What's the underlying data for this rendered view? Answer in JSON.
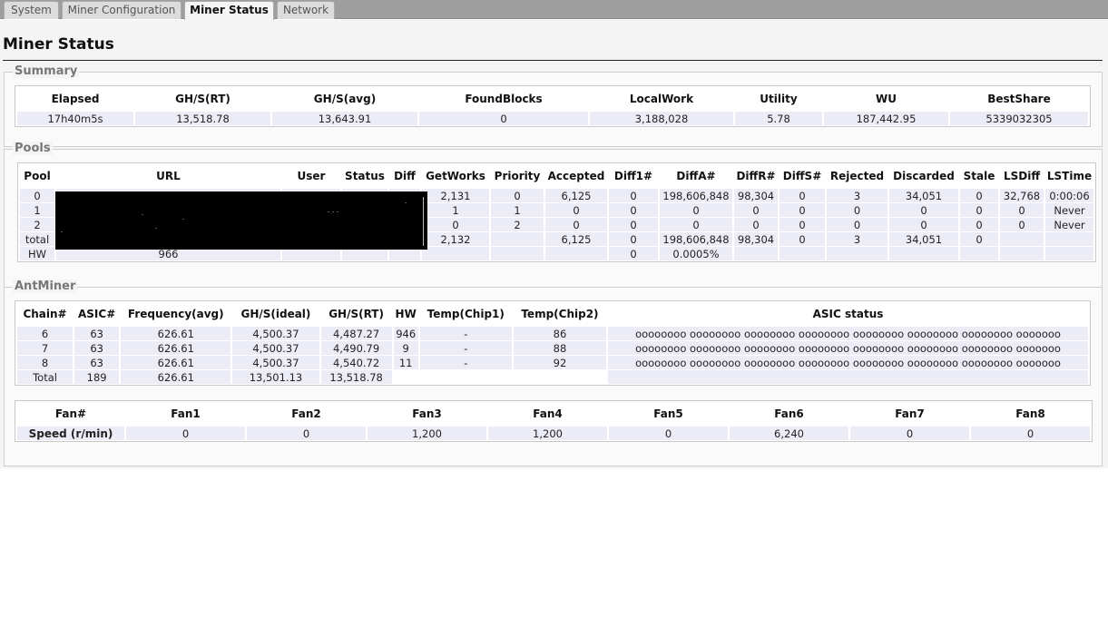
{
  "tabs": [
    {
      "label": "System",
      "active": false
    },
    {
      "label": "Miner Configuration",
      "active": false
    },
    {
      "label": "Miner Status",
      "active": true
    },
    {
      "label": "Network",
      "active": false
    }
  ],
  "page_title": "Miner Status",
  "summary": {
    "legend": "Summary",
    "headers": [
      "Elapsed",
      "GH/S(RT)",
      "GH/S(avg)",
      "FoundBlocks",
      "LocalWork",
      "Utility",
      "WU",
      "BestShare"
    ],
    "values": [
      "17h40m5s",
      "13,518.78",
      "13,643.91",
      "0",
      "3,188,028",
      "5.78",
      "187,442.95",
      "5339032305"
    ]
  },
  "pools": {
    "legend": "Pools",
    "headers": [
      "Pool",
      "URL",
      "User",
      "Status",
      "Diff",
      "GetWorks",
      "Priority",
      "Accepted",
      "Diff1#",
      "DiffA#",
      "DiffR#",
      "DiffS#",
      "Rejected",
      "Discarded",
      "Stale",
      "LSDiff",
      "LSTime"
    ],
    "rows": [
      [
        "0",
        "",
        "",
        "",
        "",
        "2,131",
        "0",
        "6,125",
        "0",
        "198,606,848",
        "98,304",
        "0",
        "3",
        "34,051",
        "0",
        "32,768",
        "0:00:06"
      ],
      [
        "1",
        "",
        "",
        "",
        "",
        "1",
        "1",
        "0",
        "0",
        "0",
        "0",
        "0",
        "0",
        "0",
        "0",
        "0",
        "Never"
      ],
      [
        "2",
        "",
        "",
        "",
        "",
        "0",
        "2",
        "0",
        "0",
        "0",
        "0",
        "0",
        "0",
        "0",
        "0",
        "0",
        "Never"
      ],
      [
        "total",
        "",
        "",
        "",
        "",
        "2,132",
        "",
        "6,125",
        "0",
        "198,606,848",
        "98,304",
        "0",
        "3",
        "34,051",
        "0",
        "",
        ""
      ],
      [
        "HW",
        "966",
        "",
        "",
        "",
        "",
        "",
        "",
        "0",
        "0.0005%",
        "",
        "",
        "",
        "",
        "",
        "",
        ""
      ]
    ]
  },
  "antminer": {
    "legend": "AntMiner",
    "headers": [
      "Chain#",
      "ASIC#",
      "Frequency(avg)",
      "GH/S(ideal)",
      "GH/S(RT)",
      "HW",
      "Temp(Chip1)",
      "Temp(Chip2)",
      "ASIC status"
    ],
    "rows": [
      [
        "6",
        "63",
        "626.61",
        "4,500.37",
        "4,487.27",
        "946",
        "-",
        "86",
        "oooooooo oooooooo oooooooo oooooooo oooooooo oooooooo oooooooo ooooooo"
      ],
      [
        "7",
        "63",
        "626.61",
        "4,500.37",
        "4,490.79",
        "9",
        "-",
        "88",
        "oooooooo oooooooo oooooooo oooooooo oooooooo oooooooo oooooooo ooooooo"
      ],
      [
        "8",
        "63",
        "626.61",
        "4,500.37",
        "4,540.72",
        "11",
        "-",
        "92",
        "oooooooo oooooooo oooooooo oooooooo oooooooo oooooooo oooooooo ooooooo"
      ],
      [
        "Total",
        "189",
        "626.61",
        "13,501.13",
        "13,518.78",
        "",
        "",
        "",
        ""
      ]
    ]
  },
  "fans": {
    "headers": [
      "Fan#",
      "Fan1",
      "Fan2",
      "Fan3",
      "Fan4",
      "Fan5",
      "Fan6",
      "Fan7",
      "Fan8"
    ],
    "row_label": "Speed (r/min)",
    "values": [
      "0",
      "0",
      "1,200",
      "1,200",
      "0",
      "6,240",
      "0",
      "0"
    ]
  },
  "colors": {
    "tabbar": "#9e9e9e",
    "cell_bg": "#ececf6",
    "redaction": "#000000"
  }
}
